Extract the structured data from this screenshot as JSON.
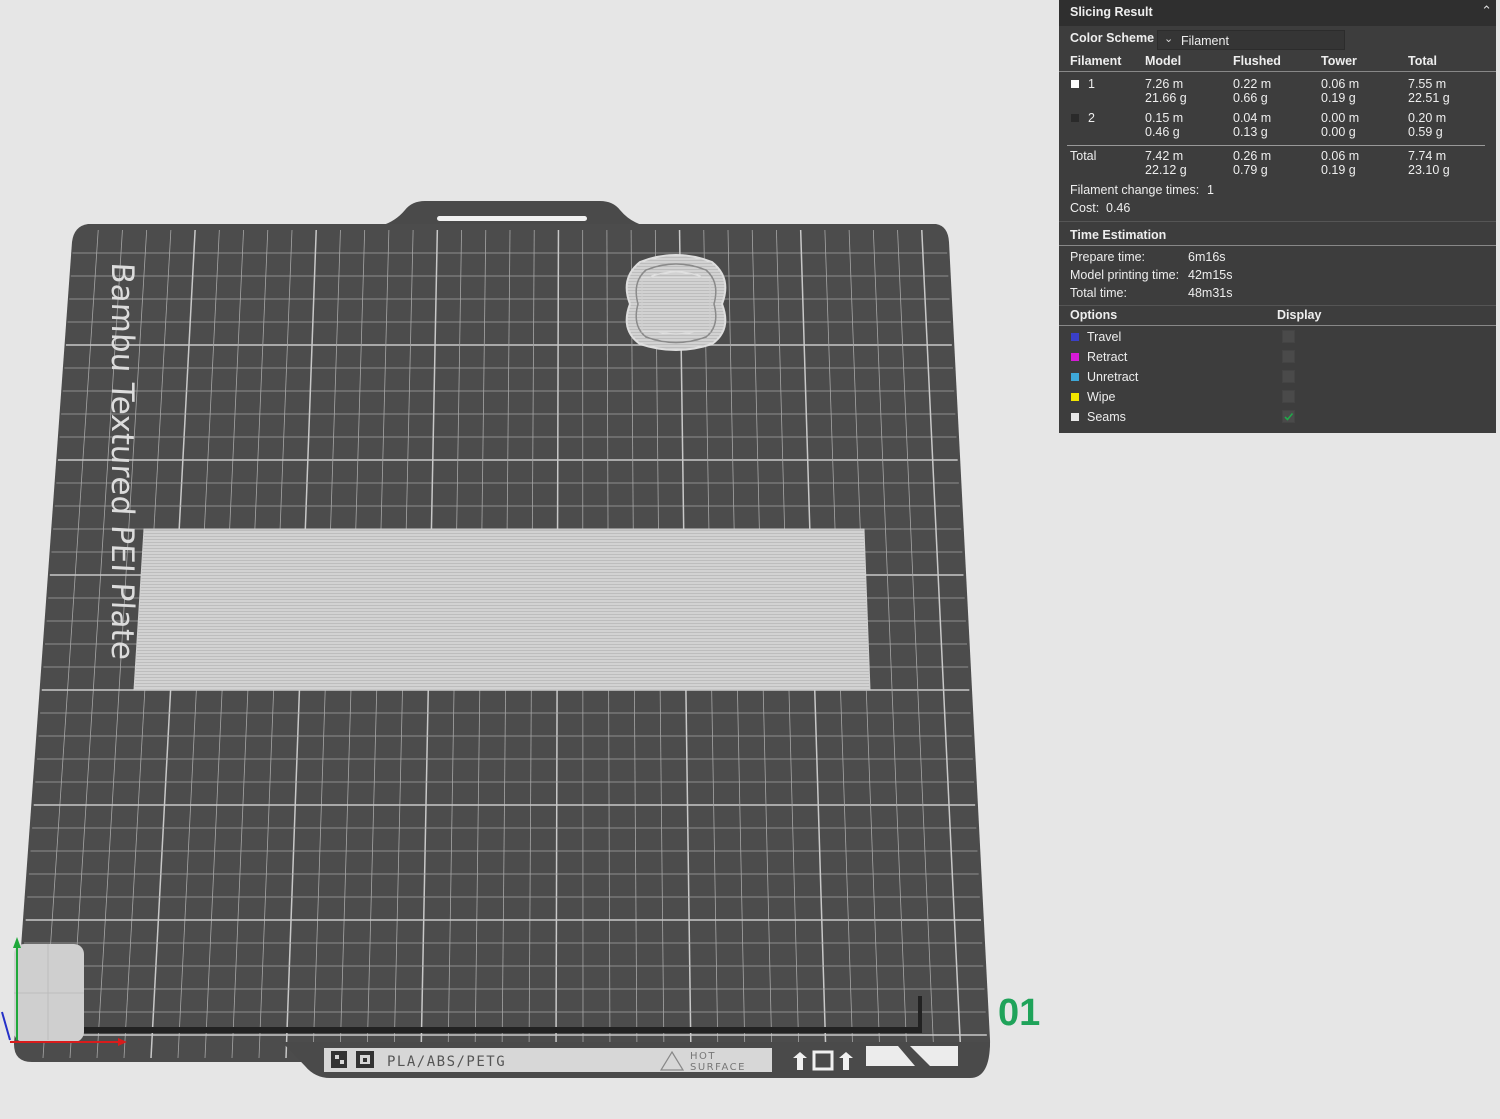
{
  "plate": {
    "name": "Bambu Textured PEI Plate",
    "footer_label": "PLA/ABS/PETG",
    "hot_line1": "HOT",
    "hot_line2": "SURFACE",
    "number": "01",
    "number_color": "#1fa35a"
  },
  "panel": {
    "title": "Slicing Result",
    "collapse_icon": "chevron-up-double-icon",
    "color_scheme_label": "Color Scheme",
    "color_scheme_value": "Filament",
    "table_headers": [
      "Filament",
      "Model",
      "Flushed",
      "Tower",
      "Total"
    ],
    "filaments": [
      {
        "id": "1",
        "color": "#ffffff",
        "model": [
          "7.26 m",
          "21.66 g"
        ],
        "flushed": [
          "0.22 m",
          "0.66 g"
        ],
        "tower": [
          "0.06 m",
          "0.19 g"
        ],
        "total": [
          "7.55 m",
          "22.51 g"
        ]
      },
      {
        "id": "2",
        "color": "#2a2a2a",
        "model": [
          "0.15 m",
          "0.46 g"
        ],
        "flushed": [
          "0.04 m",
          "0.13 g"
        ],
        "tower": [
          "0.00 m",
          "0.00 g"
        ],
        "total": [
          "0.20 m",
          "0.59 g"
        ]
      }
    ],
    "total_row": {
      "label": "Total",
      "model": [
        "7.42 m",
        "22.12 g"
      ],
      "flushed": [
        "0.26 m",
        "0.79 g"
      ],
      "tower": [
        "0.06 m",
        "0.19 g"
      ],
      "total": [
        "7.74 m",
        "23.10 g"
      ]
    },
    "filament_change_label": "Filament change times:",
    "filament_change_value": "1",
    "cost_label": "Cost:",
    "cost_value": "0.46",
    "time_title": "Time Estimation",
    "times": [
      {
        "label": "Prepare time:",
        "value": "6m16s"
      },
      {
        "label": "Model printing time:",
        "value": "42m15s"
      },
      {
        "label": "Total time:",
        "value": "48m31s"
      }
    ],
    "options_header": "Options",
    "display_header": "Display",
    "options": [
      {
        "label": "Travel",
        "color": "#3a3fc8",
        "checked": false
      },
      {
        "label": "Retract",
        "color": "#d61ad6",
        "checked": false
      },
      {
        "label": "Unretract",
        "color": "#3ea8d8",
        "checked": false
      },
      {
        "label": "Wipe",
        "color": "#f2e600",
        "checked": false
      },
      {
        "label": "Seams",
        "color": "#e8e8e8",
        "checked": true
      }
    ]
  }
}
